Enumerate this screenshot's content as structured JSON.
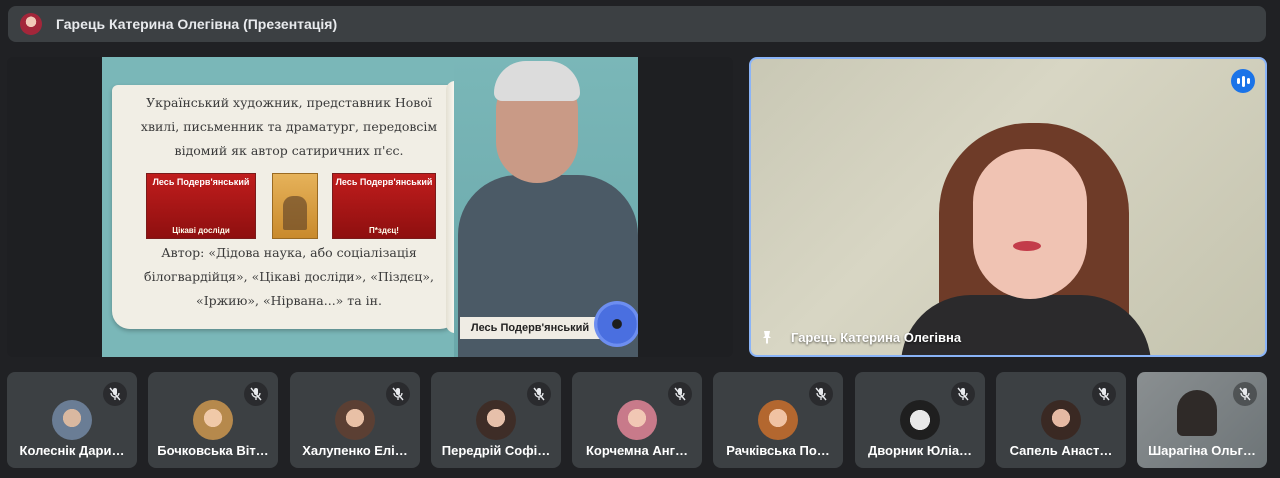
{
  "header": {
    "title": "Гарець Катерина Олегівна (Презентація)"
  },
  "slide": {
    "text": "Український художник, представник Нової хвилі, письменник та драматург, передовсім відомий як автор сатиричних п'єс.",
    "book1_title": "Лесь Подерв'янський",
    "book1_sub": "Цікаві досліди",
    "book3_title": "Лесь Подерв'янський",
    "book3_sub": "П*здєц!",
    "authors": "Автор: «Дідова наука, або соціалізація білогвардійця», «Цікаві досліди», «Піздєц», «Іржию», «Нірвана...» та ін.",
    "caption": "Лесь Подерв'янський"
  },
  "speaker": {
    "name": "Гарець Катерина Олегівна"
  },
  "participants": [
    {
      "name": "Колеснік Дари…",
      "muted": true
    },
    {
      "name": "Бочковська Віт…",
      "muted": true
    },
    {
      "name": "Халупенко Елі…",
      "muted": true
    },
    {
      "name": "Передрій Софі…",
      "muted": true
    },
    {
      "name": "Корчемна Анг…",
      "muted": true
    },
    {
      "name": "Рачківська По…",
      "muted": true
    },
    {
      "name": "Дворник Юліа…",
      "muted": true
    },
    {
      "name": "Сапель Анаст…",
      "muted": true
    },
    {
      "name": "Шарагіна Ольг…",
      "muted": true
    }
  ],
  "colors": {
    "accent": "#8ab4f8",
    "speaking": "#1a73e8",
    "tile": "#3c4043",
    "background": "#202124"
  },
  "icons": {
    "mute": "mic-off-icon",
    "speaking": "audio-bars-icon",
    "pin": "pin-icon"
  }
}
